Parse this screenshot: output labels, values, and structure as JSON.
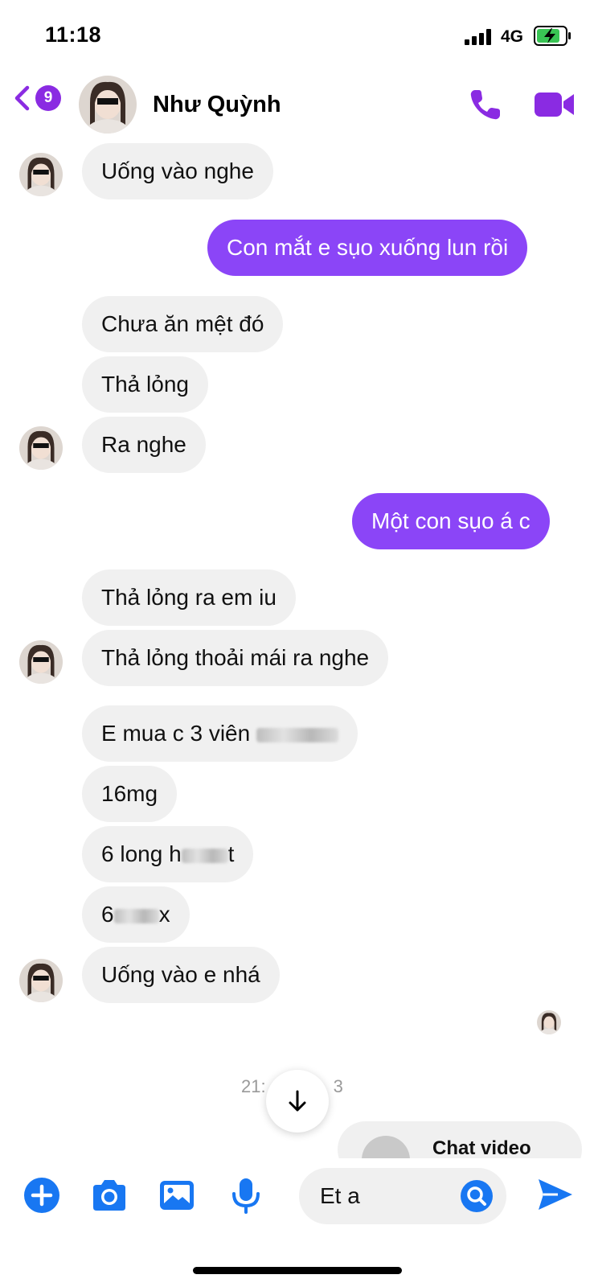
{
  "status": {
    "time": "11:18",
    "network": "4G"
  },
  "header": {
    "back_badge": "9",
    "contact_name": "Như Quỳnh"
  },
  "messages": [
    {
      "side": "in",
      "text": "Uống vào nghe"
    },
    {
      "side": "out",
      "text": "Con mắt e sụo xuống lun rồi"
    },
    {
      "side": "in",
      "text": "Chưa ăn mệt đó"
    },
    {
      "side": "in",
      "text": "Thả lỏng"
    },
    {
      "side": "in",
      "text": "Ra nghe"
    },
    {
      "side": "out",
      "text": "Một con sụo á c"
    },
    {
      "side": "in",
      "text": "Thả lỏng ra em iu"
    },
    {
      "side": "in",
      "text": "Thả lỏng thoải mái ra nghe"
    },
    {
      "side": "in",
      "text": "E mua c 3 viên",
      "redacted_tail": true
    },
    {
      "side": "in",
      "text": "16mg"
    },
    {
      "side": "in",
      "text": "6 long h",
      "redacted_mid": true,
      "tail": "t"
    },
    {
      "side": "in",
      "text": "6",
      "redacted_mid": true,
      "tail": "x"
    },
    {
      "side": "in",
      "text": "Uống vào e nhá"
    }
  ],
  "timestamp": {
    "left": "21:",
    "right": "3"
  },
  "partial_preview": "Chat video",
  "composer": {
    "input_value": "Et a"
  },
  "colors": {
    "accent": "#8b45f7",
    "brand_purple": "#8a2be2",
    "icon_blue": "#1877f2",
    "bubble_in": "#f0f0f0"
  }
}
